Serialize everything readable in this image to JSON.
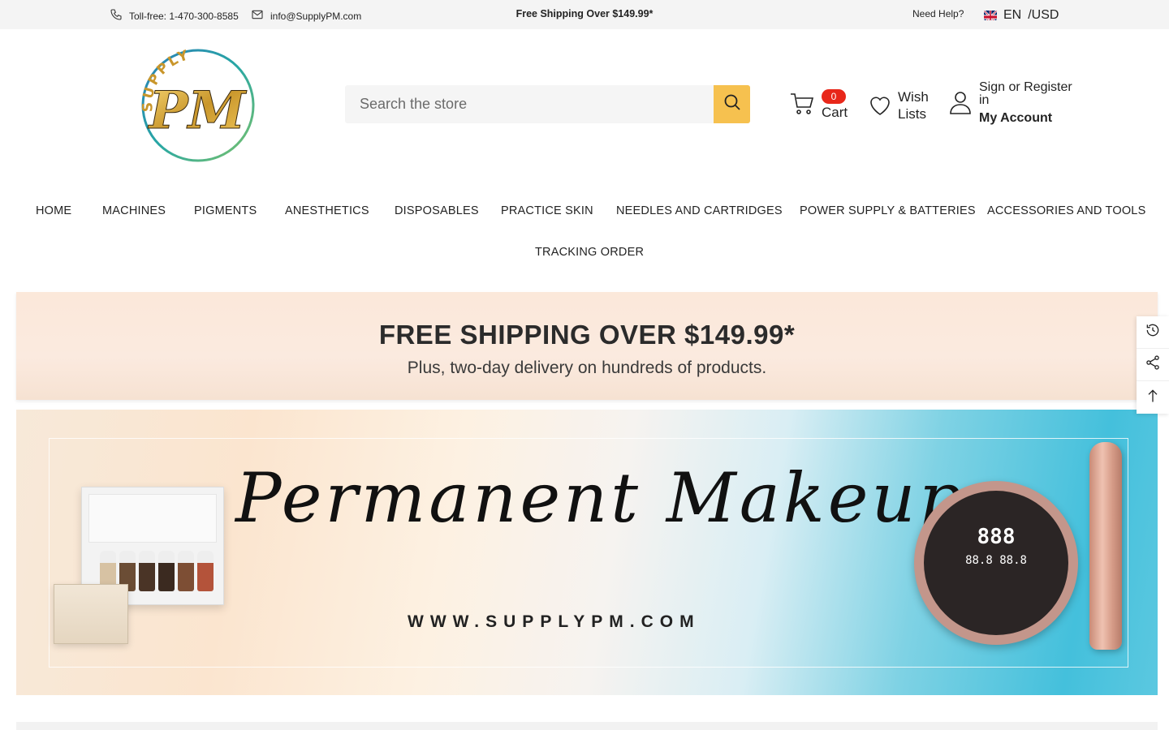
{
  "topbar": {
    "phone_label": "Toll-free: 1-470-300-8585",
    "email_label": "info@SupplyPM.com",
    "shipping_notice": "Free Shipping Over $149.99*",
    "help_label": "Need Help?",
    "language": "EN",
    "currency": "/USD"
  },
  "header": {
    "logo_top_text": "SUPPLY",
    "logo_monogram": "PM",
    "search_placeholder": "Search the store",
    "cart_count": "0",
    "cart_label": "Cart",
    "wish_label": "Wish Lists",
    "account_sign": "Sign or Register in",
    "account_my": "My Account"
  },
  "nav": {
    "items": [
      "HOME",
      "MACHINES",
      "PIGMENTS",
      "ANESTHETICS",
      "DISPOSABLES",
      "PRACTICE SKIN",
      "NEEDLES AND CARTRIDGES",
      "POWER SUPPLY & BATTERIES",
      "ACCESSORIES AND TOOLS",
      "TRACKING ORDER"
    ]
  },
  "promo_banner": {
    "title": "FREE SHIPPING OVER $149.99*",
    "subtitle": "Plus, two-day delivery on hundreds of products."
  },
  "hero_banner": {
    "script_title": "Permanent Makeup",
    "url": "WWW.SUPPLYPM.COM",
    "device_display": "888",
    "device_display_sub": "88.8 88.8"
  },
  "colors": {
    "accent": "#f6c14f",
    "badge": "#e8271a",
    "promo_bg": "#fbe8da"
  },
  "icons": {
    "phone": "phone-icon",
    "mail": "mail-icon",
    "search": "search-icon",
    "cart": "cart-icon",
    "heart": "heart-icon",
    "user": "user-icon",
    "history": "history-icon",
    "share": "share-icon",
    "arrow_up": "arrow-up-icon"
  }
}
